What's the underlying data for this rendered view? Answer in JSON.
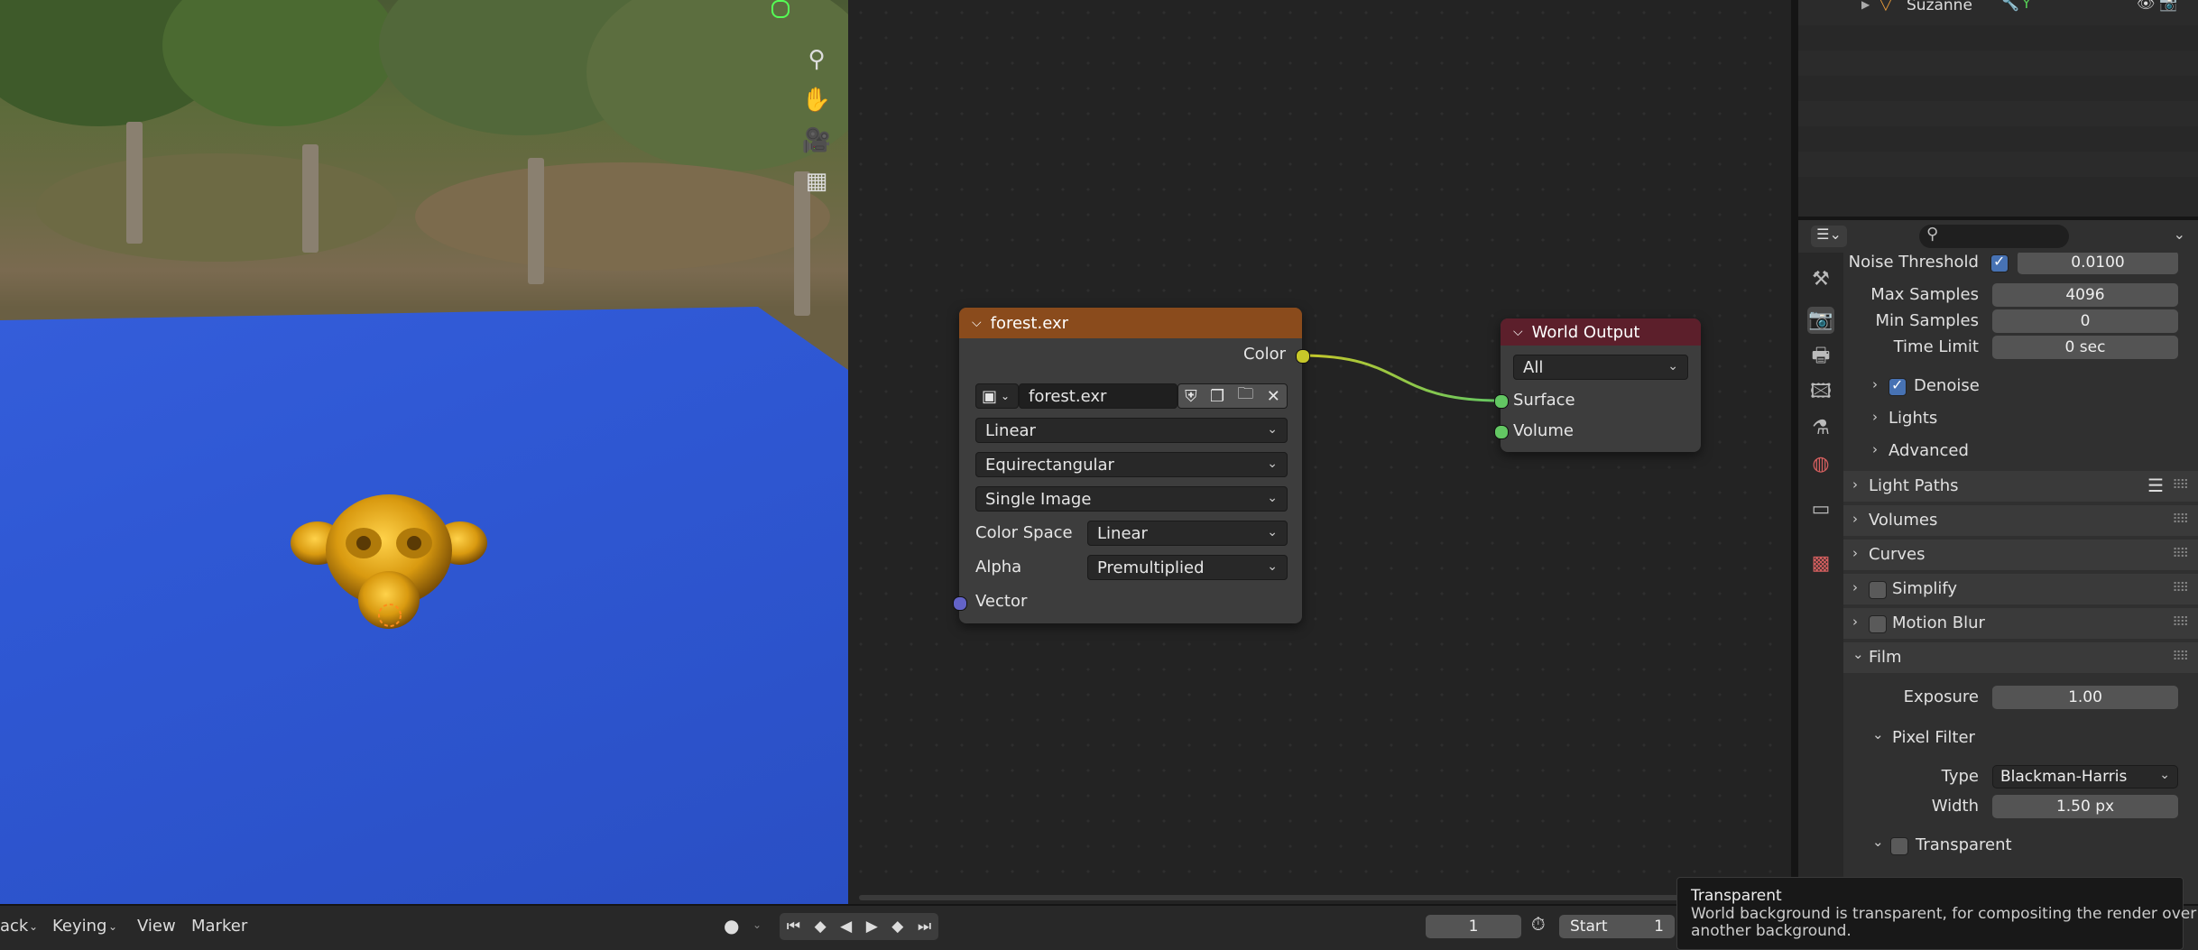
{
  "outliner": {
    "object_name": "Suzanne"
  },
  "image_node": {
    "title": "forest.exr",
    "output_label": "Color",
    "image_name": "forest.exr",
    "interpolation": "Linear",
    "projection": "Equirectangular",
    "source": "Single Image",
    "color_space_label": "Color Space",
    "color_space_value": "Linear",
    "alpha_label": "Alpha",
    "alpha_value": "Premultiplied",
    "vector_label": "Vector"
  },
  "world_output_node": {
    "title": "World Output",
    "target": "All",
    "surface_label": "Surface",
    "volume_label": "Volume"
  },
  "properties": {
    "noise_threshold_label": "Noise Threshold",
    "noise_threshold_value": "0.0100",
    "max_samples_label": "Max Samples",
    "max_samples_value": "4096",
    "min_samples_label": "Min Samples",
    "min_samples_value": "0",
    "time_limit_label": "Time Limit",
    "time_limit_value": "0 sec",
    "denoise_label": "Denoise",
    "lights_label": "Lights",
    "advanced_label": "Advanced",
    "light_paths_label": "Light Paths",
    "volumes_label": "Volumes",
    "curves_label": "Curves",
    "simplify_label": "Simplify",
    "motion_blur_label": "Motion Blur",
    "film_label": "Film",
    "exposure_label": "Exposure",
    "exposure_value": "1.00",
    "pixel_filter_label": "Pixel Filter",
    "type_label": "Type",
    "type_value": "Blackman-Harris",
    "width_label": "Width",
    "width_value": "1.50 px",
    "transparent_label": "Transparent"
  },
  "timeline": {
    "playback_fragment": "ack",
    "keying_label": "Keying",
    "view_label": "View",
    "marker_label": "Marker",
    "current_frame": "1",
    "start_label": "Start",
    "start_value": "1"
  },
  "tooltip": {
    "title": "Transparent",
    "line1": "World background is transparent, for compositing the render over",
    "line2": "another background."
  },
  "colors": {
    "image_node_header": "#8a4b1c",
    "world_output_header": "#5c1f2b",
    "color_socket": "#c7c729",
    "shader_socket": "#63c763",
    "vector_socket": "#6363c7",
    "checkbox_on": "#4772b3"
  }
}
